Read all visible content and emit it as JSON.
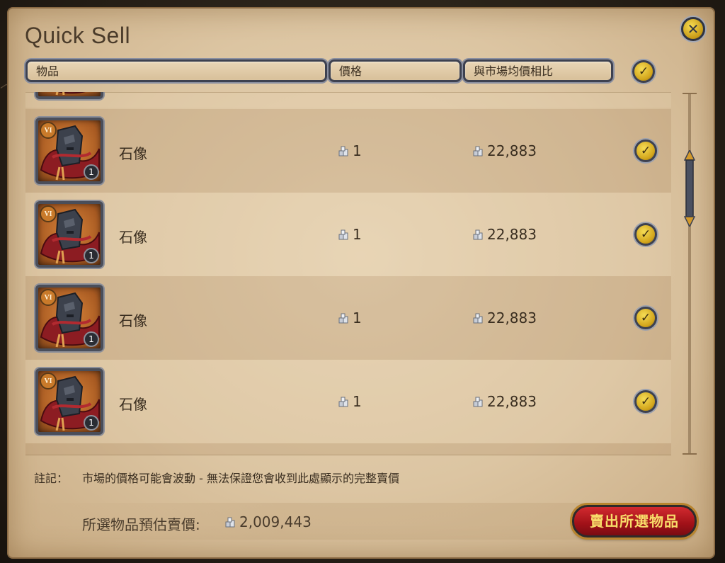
{
  "dialog": {
    "title": "Quick Sell",
    "close_symbol": "✕"
  },
  "columns": {
    "item": "物品",
    "price": "價格",
    "compare": "與市場均價相比"
  },
  "select_all_check": "✓",
  "rows": [
    {
      "tier": "VI",
      "qty": "1",
      "name": "石像",
      "price": "1",
      "market": "22,883",
      "check": "✓"
    },
    {
      "tier": "VI",
      "qty": "1",
      "name": "石像",
      "price": "1",
      "market": "22,883",
      "check": "✓"
    },
    {
      "tier": "VI",
      "qty": "1",
      "name": "石像",
      "price": "1",
      "market": "22,883",
      "check": "✓"
    },
    {
      "tier": "VI",
      "qty": "1",
      "name": "石像",
      "price": "1",
      "market": "22,883",
      "check": "✓"
    }
  ],
  "note": {
    "label": "註記：",
    "text": "市場的價格可能會波動 - 無法保證您會收到此處顯示的完整賣價"
  },
  "total": {
    "label": "所選物品預估賣價:",
    "value": "2,009,443"
  },
  "sell_button": "賣出所選物品",
  "icons": {
    "currency": "silver-coins-icon",
    "item": "stone-statue-icon",
    "check": "checkmark-icon",
    "close": "close-icon"
  },
  "colors": {
    "accent_gold": "#f5dc55",
    "sell_red": "#a01118",
    "text": "#3a2e20"
  }
}
